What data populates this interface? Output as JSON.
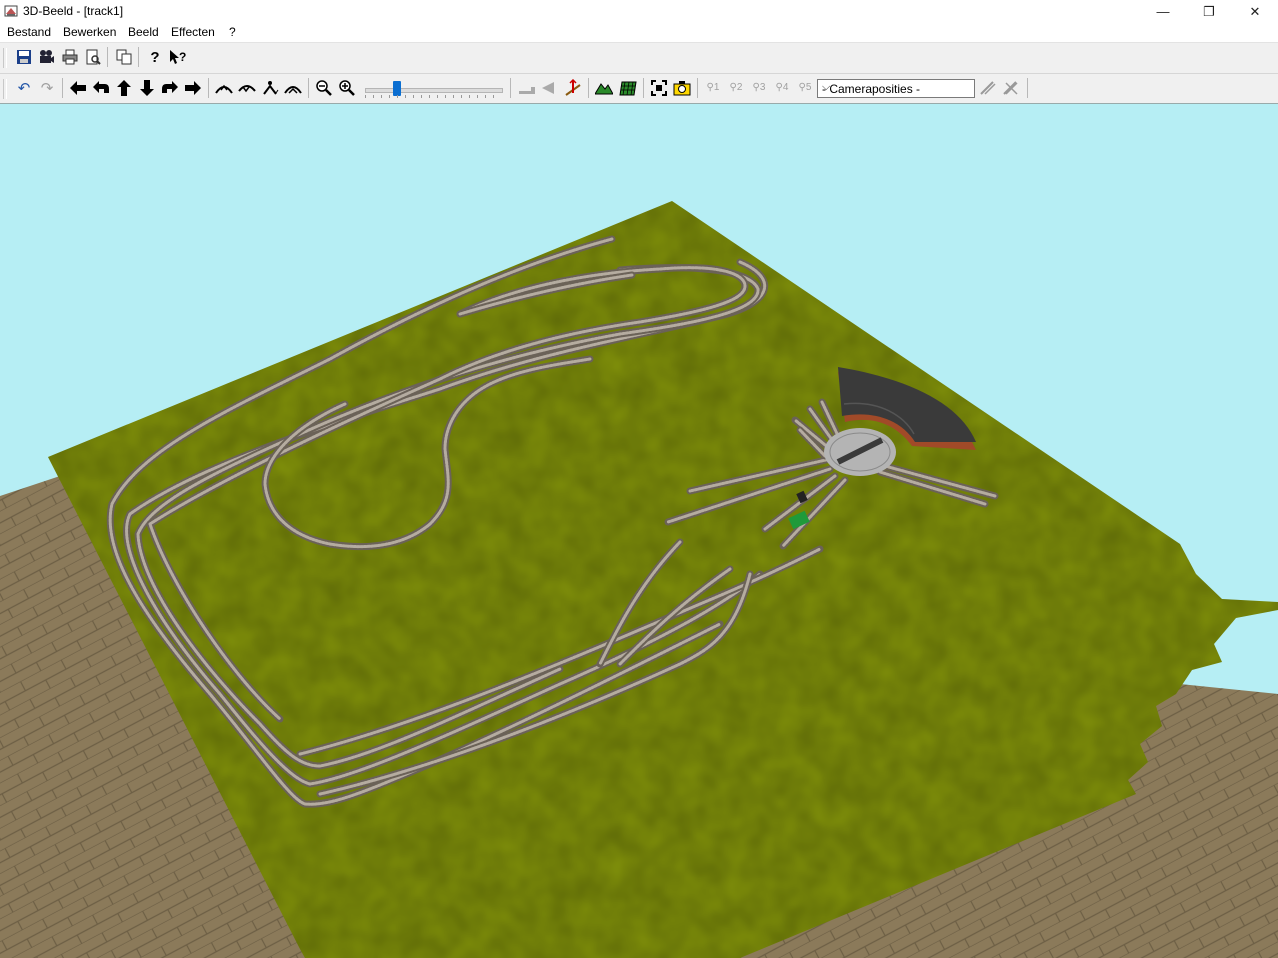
{
  "window": {
    "title": "3D-Beeld - [track1]",
    "minimize_glyph": "—",
    "restore_glyph": "❐",
    "close_glyph": "✕"
  },
  "menu": {
    "items": [
      "Bestand",
      "Bewerken",
      "Beeld",
      "Effecten",
      "?"
    ]
  },
  "toolbar1": {
    "icons": [
      {
        "name": "save-icon",
        "glyph": "💾"
      },
      {
        "name": "camera-icon",
        "glyph": "🎥"
      },
      {
        "name": "print-icon",
        "glyph": "🖶"
      },
      {
        "name": "print-preview-icon",
        "glyph": "🔍"
      },
      {
        "name": "copy-icon",
        "glyph": "⎘"
      },
      {
        "name": "help-icon",
        "glyph": "?"
      },
      {
        "name": "context-help-icon",
        "glyph": "?"
      }
    ]
  },
  "toolbar2": {
    "undo": "↶",
    "redo": "↷",
    "move_left": "🡸",
    "rotate_left": "⮌",
    "move_up": "🡹",
    "move_down": "🡻",
    "rotate_right": "⮎",
    "move_right": "🡺",
    "zoom_out": "⊖",
    "zoom_in": "⊕",
    "zoom_slider_fraction": 0.22,
    "camera_presets": [
      "1",
      "2",
      "3",
      "4",
      "5"
    ],
    "camera_dropdown": "- Cameraposities -"
  },
  "colors": {
    "sky": "#b6eef4",
    "grass": "#7f8f0a",
    "brick": "#8b7a5a",
    "track": "#6b6258",
    "rail": "#b5aca0",
    "shed_roof": "#3a3a3a",
    "shed_wall": "#a14a28",
    "turntable": "#b4b4b4"
  }
}
